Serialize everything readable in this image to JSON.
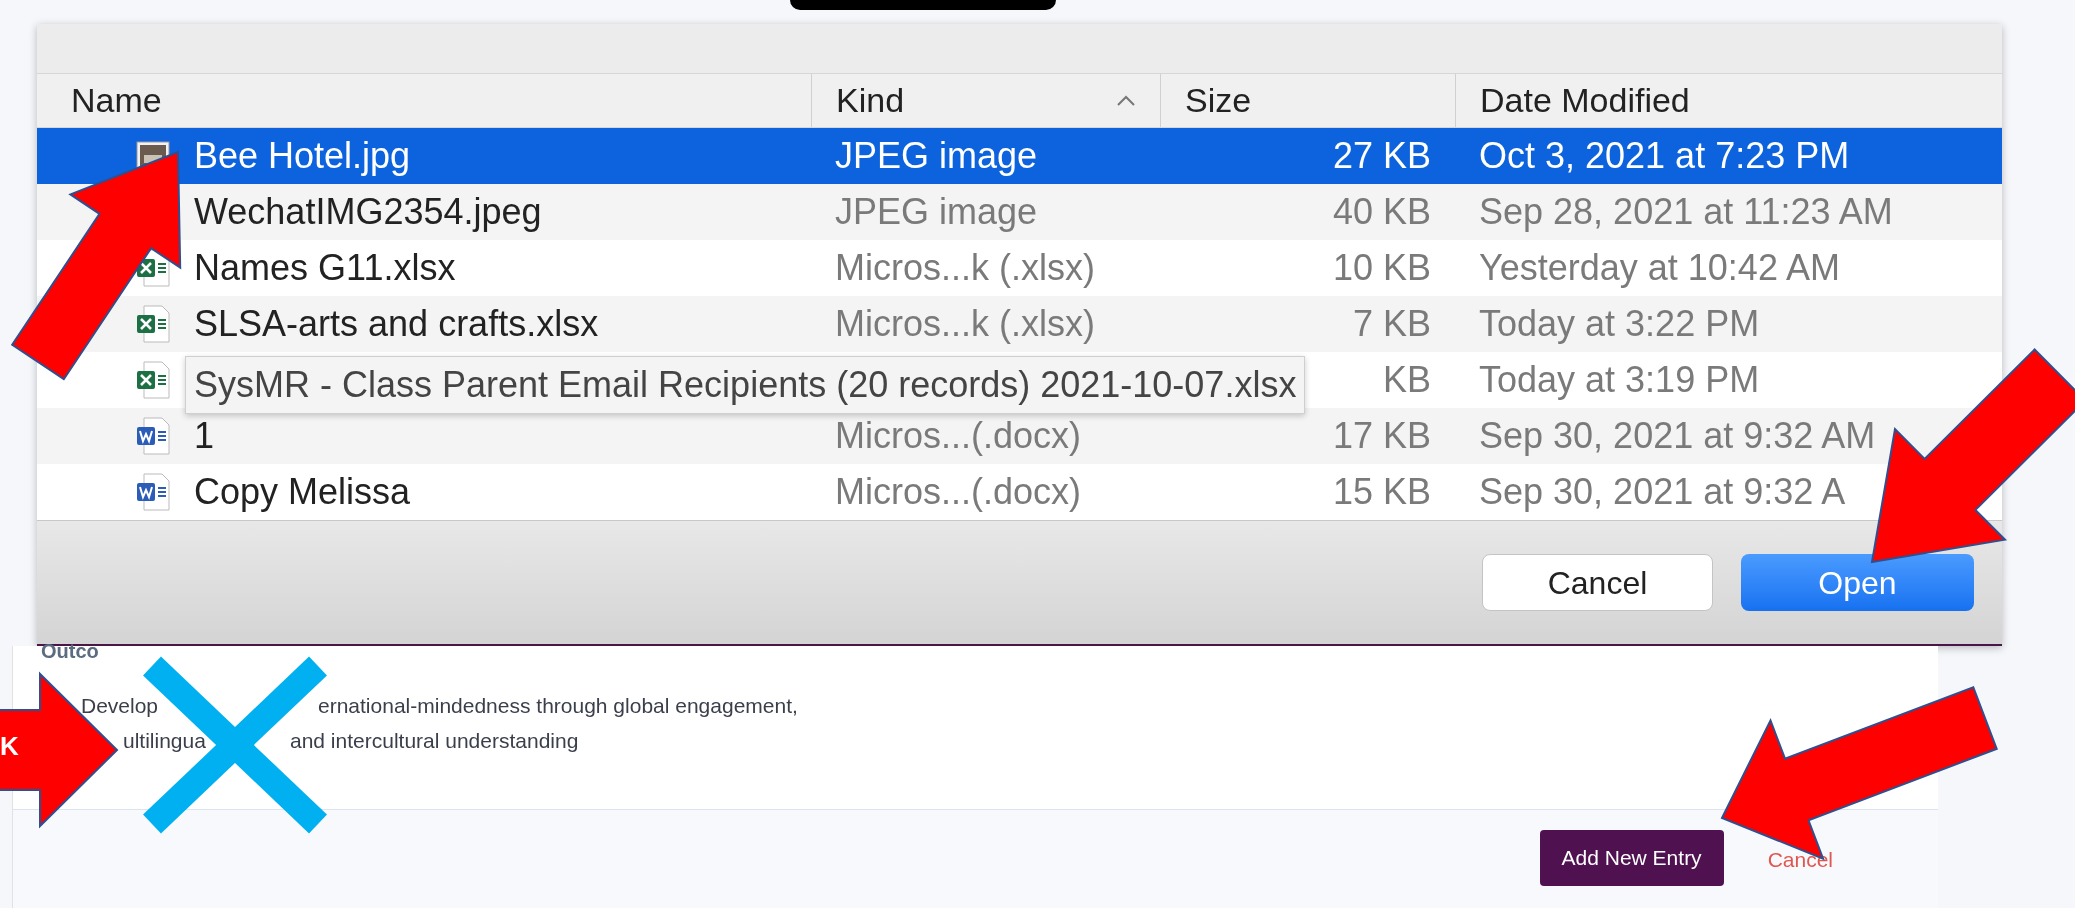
{
  "file_dialog": {
    "columns": [
      {
        "label": "Name",
        "sorted": false
      },
      {
        "label": "Kind",
        "sorted": true
      },
      {
        "label": "Size",
        "sorted": false
      },
      {
        "label": "Date Modified",
        "sorted": false
      }
    ],
    "files": [
      {
        "kind": "image",
        "name": "Bee Hotel.jpg",
        "file_type": "JPEG image",
        "size": "27 KB",
        "modified": "Oct 3, 2021 at 7:23 PM",
        "selected": true
      },
      {
        "kind": "plain",
        "name": "WechatIMG2354.jpeg",
        "file_type": "JPEG image",
        "size": "40 KB",
        "modified": "Sep 28, 2021 at 11:23 AM",
        "selected": false
      },
      {
        "kind": "spreadsheet",
        "name": "Names G11.xlsx",
        "file_type": "Micros...k (.xlsx)",
        "size": "10 KB",
        "modified": "Yesterday at 10:42 AM",
        "selected": false
      },
      {
        "kind": "spreadsheet",
        "name": "SLSA-arts and crafts.xlsx",
        "file_type": "Micros...k (.xlsx)",
        "size": "7 KB",
        "modified": "Today at 3:22 PM",
        "selected": false
      },
      {
        "kind": "spreadsheet",
        "size": "KB",
        "modified": "Today at 3:19 PM",
        "selected": false
      },
      {
        "kind": "document",
        "name": "1",
        "file_type": "Micros...(.docx)",
        "size": "17 KB",
        "modified": "Sep 30, 2021 at 9:32 AM",
        "selected": false
      },
      {
        "kind": "document",
        "name": "Copy Melissa",
        "file_type": "Micros...(.docx)",
        "size": "15 KB",
        "modified": "Sep 30, 2021 at 9:32 A",
        "selected": false
      }
    ],
    "tooltip": "SysMR - Class Parent Email Recipients (20 records) 2021-10-07.xlsx",
    "buttons": [
      {
        "label": "Cancel",
        "kind": "secondary"
      },
      {
        "label": "Open",
        "kind": "primary"
      }
    ]
  },
  "page": {
    "section_label": "Outco",
    "outcome_lines": [
      [
        "Develop",
        "ernational-mindedness through global engagement,"
      ],
      [
        "ultilingua",
        "and intercultural understanding"
      ]
    ],
    "add_button": "Add New Entry",
    "cancel_link": "Cancel"
  },
  "annotations": {
    "arrow_label": "K"
  }
}
